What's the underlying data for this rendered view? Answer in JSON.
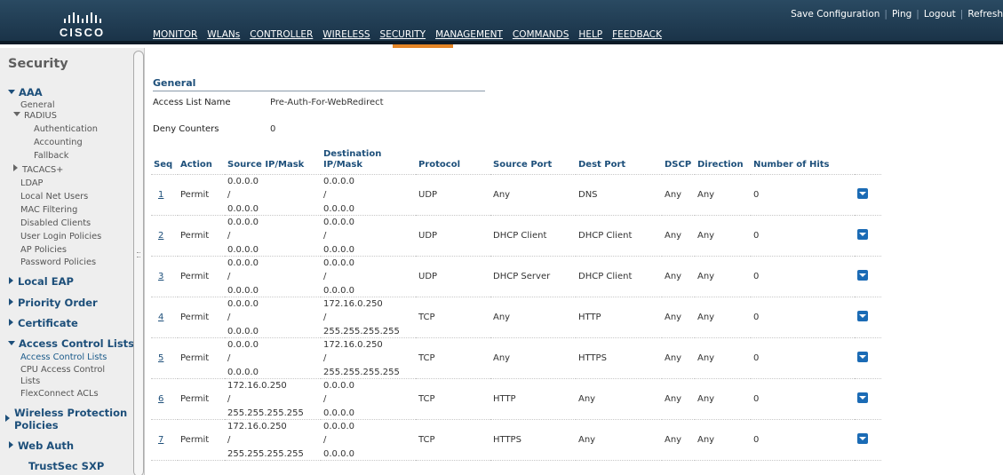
{
  "brand": {
    "name": "CISCO"
  },
  "toplinks": [
    "Save Configuration",
    "Ping",
    "Logout",
    "Refresh"
  ],
  "nav": [
    "MONITOR",
    "WLANs",
    "CONTROLLER",
    "WIRELESS",
    "SECURITY",
    "MANAGEMENT",
    "COMMANDS",
    "HELP",
    "FEEDBACK"
  ],
  "nav_active": "SECURITY",
  "colors": {
    "topbar": "#1f3d55",
    "active_tab": "#e38526",
    "heading": "#1d4f7a",
    "dropdown": "#1b6bb5"
  },
  "sidebar": {
    "title": "Security",
    "aaa": {
      "label": "AAA",
      "general": "General",
      "radius": "RADIUS",
      "radius_items": [
        "Authentication",
        "Accounting",
        "Fallback"
      ],
      "tacacs": "TACACS+",
      "items": [
        "LDAP",
        "Local Net Users",
        "MAC Filtering",
        "Disabled Clients",
        "User Login Policies",
        "AP Policies",
        "Password Policies"
      ]
    },
    "local_eap": "Local EAP",
    "priority_order": "Priority Order",
    "certificate": "Certificate",
    "acl": {
      "label": "Access Control Lists",
      "items": [
        "Access Control Lists",
        "CPU Access Control",
        "Lists",
        "FlexConnect ACLs"
      ]
    },
    "wireless_protection": [
      "Wireless Protection",
      "Policies"
    ],
    "web_auth": "Web Auth",
    "trustsec": "TrustSec SXP"
  },
  "general": {
    "heading": "General",
    "acl_name_label": "Access List Name",
    "acl_name_value": "Pre-Auth-For-WebRedirect",
    "deny_label": "Deny Counters",
    "deny_value": "0"
  },
  "table": {
    "headers": {
      "seq": "Seq",
      "action": "Action",
      "src": "Source IP/Mask",
      "dst1": "Destination",
      "dst2": "IP/Mask",
      "protocol": "Protocol",
      "src_port": "Source Port",
      "dst_port": "Dest Port",
      "dscp": "DSCP",
      "direction": "Direction",
      "hits": "Number of Hits"
    },
    "separator": "/",
    "rows": [
      {
        "seq": "1",
        "action": "Permit",
        "src_ip": "0.0.0.0",
        "src_mask": "0.0.0.0",
        "dst_ip": "0.0.0.0",
        "dst_mask": "0.0.0.0",
        "protocol": "UDP",
        "src_port": "Any",
        "dst_port": "DNS",
        "dscp": "Any",
        "direction": "Any",
        "hits": "0"
      },
      {
        "seq": "2",
        "action": "Permit",
        "src_ip": "0.0.0.0",
        "src_mask": "0.0.0.0",
        "dst_ip": "0.0.0.0",
        "dst_mask": "0.0.0.0",
        "protocol": "UDP",
        "src_port": "DHCP Client",
        "dst_port": "DHCP Client",
        "dscp": "Any",
        "direction": "Any",
        "hits": "0"
      },
      {
        "seq": "3",
        "action": "Permit",
        "src_ip": "0.0.0.0",
        "src_mask": "0.0.0.0",
        "dst_ip": "0.0.0.0",
        "dst_mask": "0.0.0.0",
        "protocol": "UDP",
        "src_port": "DHCP Server",
        "dst_port": "DHCP Client",
        "dscp": "Any",
        "direction": "Any",
        "hits": "0"
      },
      {
        "seq": "4",
        "action": "Permit",
        "src_ip": "0.0.0.0",
        "src_mask": "0.0.0.0",
        "dst_ip": "172.16.0.250",
        "dst_mask": "255.255.255.255",
        "protocol": "TCP",
        "src_port": "Any",
        "dst_port": "HTTP",
        "dscp": "Any",
        "direction": "Any",
        "hits": "0"
      },
      {
        "seq": "5",
        "action": "Permit",
        "src_ip": "0.0.0.0",
        "src_mask": "0.0.0.0",
        "dst_ip": "172.16.0.250",
        "dst_mask": "255.255.255.255",
        "protocol": "TCP",
        "src_port": "Any",
        "dst_port": "HTTPS",
        "dscp": "Any",
        "direction": "Any",
        "hits": "0"
      },
      {
        "seq": "6",
        "action": "Permit",
        "src_ip": "172.16.0.250",
        "src_mask": "255.255.255.255",
        "dst_ip": "0.0.0.0",
        "dst_mask": "0.0.0.0",
        "protocol": "TCP",
        "src_port": "HTTP",
        "dst_port": "Any",
        "dscp": "Any",
        "direction": "Any",
        "hits": "0"
      },
      {
        "seq": "7",
        "action": "Permit",
        "src_ip": "172.16.0.250",
        "src_mask": "255.255.255.255",
        "dst_ip": "0.0.0.0",
        "dst_mask": "0.0.0.0",
        "protocol": "TCP",
        "src_port": "HTTPS",
        "dst_port": "Any",
        "dscp": "Any",
        "direction": "Any",
        "hits": "0"
      }
    ]
  }
}
